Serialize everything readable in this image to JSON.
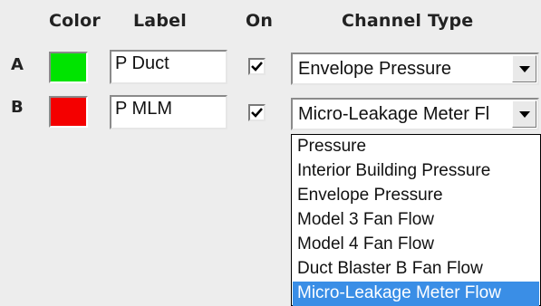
{
  "headers": {
    "color": "Color",
    "label": "Label",
    "on": "On",
    "channel_type": "Channel Type"
  },
  "rows": [
    {
      "id": "A",
      "color": "#00e400",
      "label_value": "P Duct",
      "on": true,
      "channel_type": "Envelope Pressure"
    },
    {
      "id": "B",
      "color": "#f40000",
      "label_value": "P MLM",
      "on": true,
      "channel_type": "Micro-Leakage Meter Fl"
    }
  ],
  "dropdown": {
    "options": [
      "Pressure",
      "Interior Building Pressure",
      "Envelope Pressure",
      "Model 3 Fan Flow",
      "Model 4 Fan Flow",
      "Duct Blaster B Fan Flow",
      "Micro-Leakage Meter Flow"
    ],
    "highlighted": "Micro-Leakage Meter Flow",
    "highlight_color": "#3a8ee6"
  },
  "icons": {
    "check": "checkmark-icon",
    "arrow": "chevron-down-icon"
  }
}
